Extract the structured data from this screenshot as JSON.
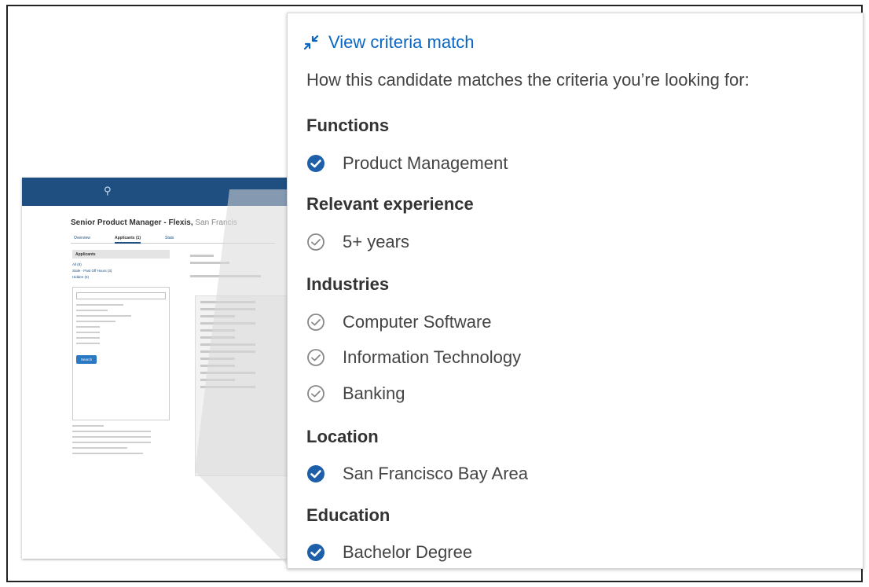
{
  "background_page": {
    "title": "Senior Product Manager - Flexis,",
    "location": "San Francis",
    "tabs": [
      "Overview",
      "Applicants (1)",
      "Stats"
    ],
    "left_head": "Applicants",
    "left_lines": [
      "All (8)",
      "Stale - Past Off Hours (3)",
      "Hidden (6)"
    ],
    "search_button": "Search",
    "colors": {
      "topbar": "#1f4f80",
      "button": "#2b79c3"
    }
  },
  "panel": {
    "header_link": "View criteria match",
    "intro": "How this candidate matches the criteria you’re looking for:",
    "sections": [
      {
        "title": "Functions",
        "items": [
          {
            "label": "Product Management",
            "status": "filled-check-icon"
          }
        ]
      },
      {
        "title": "Relevant experience",
        "items": [
          {
            "label": "5+ years",
            "status": "outline-check-icon"
          }
        ]
      },
      {
        "title": "Industries",
        "items": [
          {
            "label": "Computer Software",
            "status": "outline-check-icon"
          },
          {
            "label": "Information Technology",
            "status": "outline-check-icon"
          },
          {
            "label": "Banking",
            "status": "outline-check-icon"
          }
        ]
      },
      {
        "title": "Location",
        "items": [
          {
            "label": "San Francisco Bay Area",
            "status": "filled-check-icon"
          }
        ]
      },
      {
        "title": "Education",
        "items": [
          {
            "label": "Bachelor Degree",
            "status": "filled-check-icon"
          }
        ]
      }
    ],
    "colors": {
      "link": "#0a66c2",
      "filled_check": "#1d5fa8",
      "outline_check": "#888888"
    }
  }
}
